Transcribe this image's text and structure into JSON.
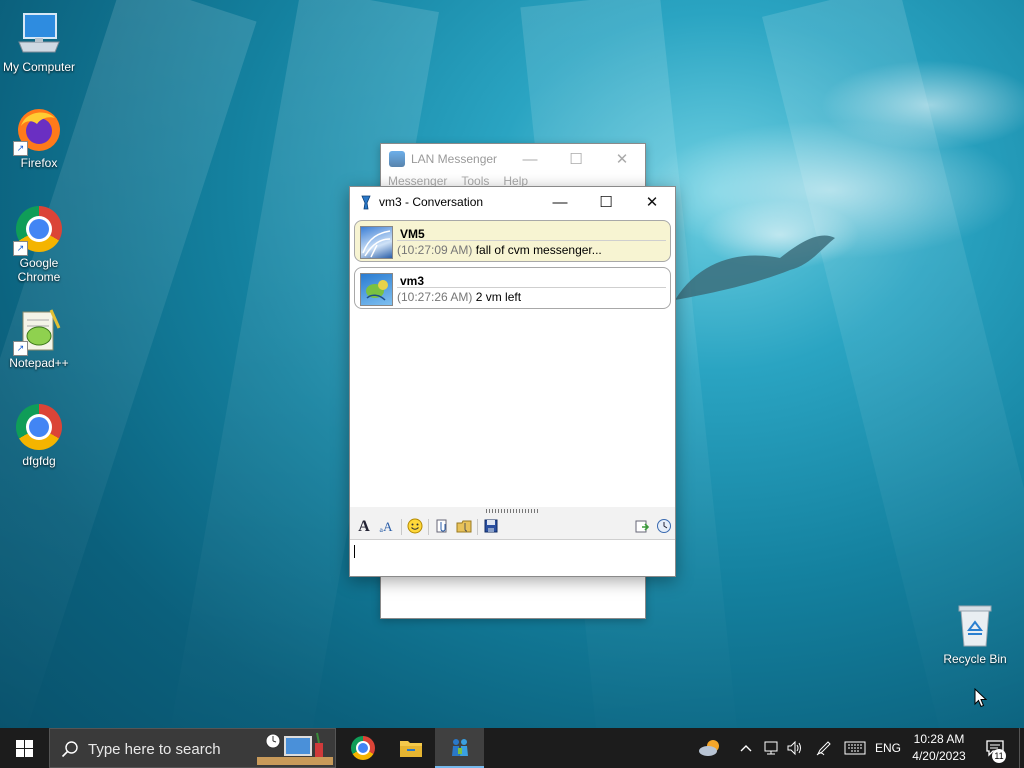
{
  "desktop": {
    "icons": [
      {
        "label": "My Computer"
      },
      {
        "label": "Firefox"
      },
      {
        "label": "Google Chrome"
      },
      {
        "label": "Notepad++"
      },
      {
        "label": "dfgfdg"
      },
      {
        "label": "Recycle Bin"
      }
    ]
  },
  "lan_window": {
    "title": "LAN Messenger",
    "menu": [
      "Messenger",
      "Tools",
      "Help"
    ]
  },
  "conversation": {
    "title": "vm3 - Conversation",
    "messages": [
      {
        "sender": "VM5",
        "time": "(10:27:09 AM)",
        "text": "fall of cvm messenger..."
      },
      {
        "sender": "vm3",
        "time": "(10:27:26 AM)",
        "text": "2 vm left"
      }
    ],
    "input_value": ""
  },
  "taskbar": {
    "search_placeholder": "Type here to search",
    "language": "ENG",
    "time": "10:28 AM",
    "date": "4/20/2023",
    "notification_count": "11"
  },
  "colors": {
    "taskbar_bg": "#1c1c1c",
    "bubble_highlight": "#f7f4d2",
    "accent_blue": "#0078d7"
  }
}
